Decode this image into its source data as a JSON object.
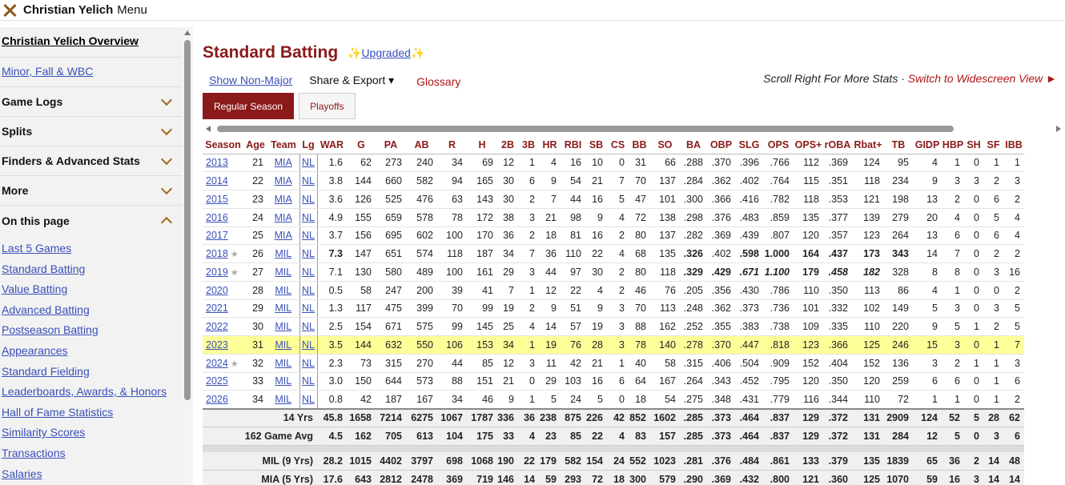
{
  "topbar": {
    "name": "Christian Yelich",
    "menu": "Menu"
  },
  "sidebar": {
    "overview": "Christian Yelich Overview",
    "minor": "Minor, Fall & WBC",
    "sections": [
      "Game Logs",
      "Splits",
      "Finders & Advanced Stats",
      "More",
      "On this page"
    ],
    "toc": [
      "Last 5 Games",
      "Standard Batting",
      "Value Batting",
      "Advanced Batting",
      "Postseason Batting",
      "Appearances",
      "Standard Fielding",
      "Leaderboards, Awards, & Honors",
      "Hall of Fame Statistics",
      "Similarity Scores",
      "Transactions",
      "Salaries"
    ]
  },
  "main": {
    "title": "Standard Batting",
    "upgraded": "Upgraded",
    "sparkle": "✨",
    "show_non_major": "Show Non-Major",
    "share_export": "Share & Export",
    "glossary": "Glossary",
    "scroll_right": "Scroll Right For More Stats",
    "sep": " · ",
    "widescreen": "Switch to Widescreen View",
    "tabs": [
      "Regular Season",
      "Playoffs"
    ]
  },
  "table": {
    "headers": [
      "Season",
      "Age",
      "Team",
      "Lg",
      "WAR",
      "G",
      "PA",
      "AB",
      "R",
      "H",
      "2B",
      "3B",
      "HR",
      "RBI",
      "SB",
      "CS",
      "BB",
      "SO",
      "BA",
      "OBP",
      "SLG",
      "OPS",
      "OPS+",
      "rOBA",
      "Rbat+",
      "TB",
      "GIDP",
      "HBP",
      "SH",
      "SF",
      "IBB"
    ],
    "rows": [
      [
        "2013",
        "21",
        "MIA",
        "NL",
        "1.6",
        "62",
        "273",
        "240",
        "34",
        "69",
        "12",
        "1",
        "4",
        "16",
        "10",
        "0",
        "31",
        "66",
        ".288",
        ".370",
        ".396",
        ".766",
        "112",
        ".369",
        "124",
        "95",
        "4",
        "1",
        "0",
        "1",
        "1"
      ],
      [
        "2014",
        "22",
        "MIA",
        "NL",
        "3.8",
        "144",
        "660",
        "582",
        "94",
        "165",
        "30",
        "6",
        "9",
        "54",
        "21",
        "7",
        "70",
        "137",
        ".284",
        ".362",
        ".402",
        ".764",
        "115",
        ".351",
        "118",
        "234",
        "9",
        "3",
        "3",
        "2",
        "3"
      ],
      [
        "2015",
        "23",
        "MIA",
        "NL",
        "3.6",
        "126",
        "525",
        "476",
        "63",
        "143",
        "30",
        "2",
        "7",
        "44",
        "16",
        "5",
        "47",
        "101",
        ".300",
        ".366",
        ".416",
        ".782",
        "118",
        ".353",
        "121",
        "198",
        "13",
        "2",
        "0",
        "6",
        "2"
      ],
      [
        "2016",
        "24",
        "MIA",
        "NL",
        "4.9",
        "155",
        "659",
        "578",
        "78",
        "172",
        "38",
        "3",
        "21",
        "98",
        "9",
        "4",
        "72",
        "138",
        ".298",
        ".376",
        ".483",
        ".859",
        "135",
        ".377",
        "139",
        "279",
        "20",
        "4",
        "0",
        "5",
        "4"
      ],
      [
        "2017",
        "25",
        "MIA",
        "NL",
        "3.7",
        "156",
        "695",
        "602",
        "100",
        "170",
        "36",
        "2",
        "18",
        "81",
        "16",
        "2",
        "80",
        "137",
        ".282",
        ".369",
        ".439",
        ".807",
        "120",
        ".357",
        "123",
        "264",
        "13",
        "6",
        "0",
        "6",
        "4"
      ],
      [
        "2018",
        "26",
        "MIL",
        "NL",
        "7.3",
        "147",
        "651",
        "574",
        "118",
        "187",
        "34",
        "7",
        "36",
        "110",
        "22",
        "4",
        "68",
        "135",
        ".326",
        ".402",
        ".598",
        "1.000",
        "164",
        ".437",
        "173",
        "343",
        "14",
        "7",
        "0",
        "2",
        "2"
      ],
      [
        "2019",
        "27",
        "MIL",
        "NL",
        "7.1",
        "130",
        "580",
        "489",
        "100",
        "161",
        "29",
        "3",
        "44",
        "97",
        "30",
        "2",
        "80",
        "118",
        ".329",
        ".429",
        ".671",
        "1.100",
        "179",
        ".458",
        "182",
        "328",
        "8",
        "8",
        "0",
        "3",
        "16"
      ],
      [
        "2020",
        "28",
        "MIL",
        "NL",
        "0.5",
        "58",
        "247",
        "200",
        "39",
        "41",
        "7",
        "1",
        "12",
        "22",
        "4",
        "2",
        "46",
        "76",
        ".205",
        ".356",
        ".430",
        ".786",
        "110",
        ".350",
        "113",
        "86",
        "4",
        "1",
        "0",
        "0",
        "2"
      ],
      [
        "2021",
        "29",
        "MIL",
        "NL",
        "1.3",
        "117",
        "475",
        "399",
        "70",
        "99",
        "19",
        "2",
        "9",
        "51",
        "9",
        "3",
        "70",
        "113",
        ".248",
        ".362",
        ".373",
        ".736",
        "101",
        ".332",
        "102",
        "149",
        "5",
        "3",
        "0",
        "3",
        "5"
      ],
      [
        "2022",
        "30",
        "MIL",
        "NL",
        "2.5",
        "154",
        "671",
        "575",
        "99",
        "145",
        "25",
        "4",
        "14",
        "57",
        "19",
        "3",
        "88",
        "162",
        ".252",
        ".355",
        ".383",
        ".738",
        "109",
        ".335",
        "110",
        "220",
        "9",
        "5",
        "1",
        "2",
        "5"
      ],
      [
        "2023",
        "31",
        "MIL",
        "NL",
        "3.5",
        "144",
        "632",
        "550",
        "106",
        "153",
        "34",
        "1",
        "19",
        "76",
        "28",
        "3",
        "78",
        "140",
        ".278",
        ".370",
        ".447",
        ".818",
        "123",
        ".366",
        "125",
        "246",
        "15",
        "3",
        "0",
        "1",
        "7"
      ],
      [
        "2024",
        "32",
        "MIL",
        "NL",
        "2.3",
        "73",
        "315",
        "270",
        "44",
        "85",
        "12",
        "3",
        "11",
        "42",
        "21",
        "1",
        "40",
        "58",
        ".315",
        ".406",
        ".504",
        ".909",
        "152",
        ".404",
        "152",
        "136",
        "3",
        "2",
        "1",
        "1",
        "3"
      ],
      [
        "2025",
        "33",
        "MIL",
        "NL",
        "3.0",
        "150",
        "644",
        "573",
        "88",
        "151",
        "21",
        "0",
        "29",
        "103",
        "16",
        "6",
        "64",
        "167",
        ".264",
        ".343",
        ".452",
        ".795",
        "120",
        ".350",
        "120",
        "259",
        "6",
        "6",
        "0",
        "1",
        "6"
      ],
      [
        "2026",
        "34",
        "MIL",
        "NL",
        "0.8",
        "42",
        "187",
        "167",
        "34",
        "46",
        "9",
        "1",
        "5",
        "24",
        "5",
        "0",
        "18",
        "54",
        ".275",
        ".348",
        ".431",
        ".779",
        "116",
        ".344",
        "110",
        "72",
        "1",
        "1",
        "0",
        "1",
        "2"
      ]
    ],
    "summary": [
      {
        "label": "14 Yrs",
        "values": [
          "45.8",
          "1658",
          "7214",
          "6275",
          "1067",
          "1787",
          "336",
          "36",
          "238",
          "875",
          "226",
          "42",
          "852",
          "1602",
          ".285",
          ".373",
          ".464",
          ".837",
          "129",
          ".372",
          "131",
          "2909",
          "124",
          "52",
          "5",
          "28",
          "62"
        ]
      },
      {
        "label": "162 Game Avg",
        "values": [
          "4.5",
          "162",
          "705",
          "613",
          "104",
          "175",
          "33",
          "4",
          "23",
          "85",
          "22",
          "4",
          "83",
          "157",
          ".285",
          ".373",
          ".464",
          ".837",
          "129",
          ".372",
          "131",
          "284",
          "12",
          "5",
          "0",
          "3",
          "6"
        ]
      },
      {
        "label": "MIL (9 Yrs)",
        "values": [
          "28.2",
          "1015",
          "4402",
          "3797",
          "698",
          "1068",
          "190",
          "22",
          "179",
          "582",
          "154",
          "24",
          "552",
          "1023",
          ".281",
          ".376",
          ".484",
          ".861",
          "133",
          ".379",
          "135",
          "1839",
          "65",
          "36",
          "2",
          "14",
          "48"
        ]
      },
      {
        "label": "MIA (5 Yrs)",
        "values": [
          "17.6",
          "643",
          "2812",
          "2478",
          "369",
          "719",
          "146",
          "14",
          "59",
          "293",
          "72",
          "18",
          "300",
          "579",
          ".290",
          ".369",
          ".432",
          ".800",
          "121",
          ".360",
          "125",
          "1070",
          "59",
          "16",
          "3",
          "14",
          "14"
        ]
      }
    ]
  }
}
